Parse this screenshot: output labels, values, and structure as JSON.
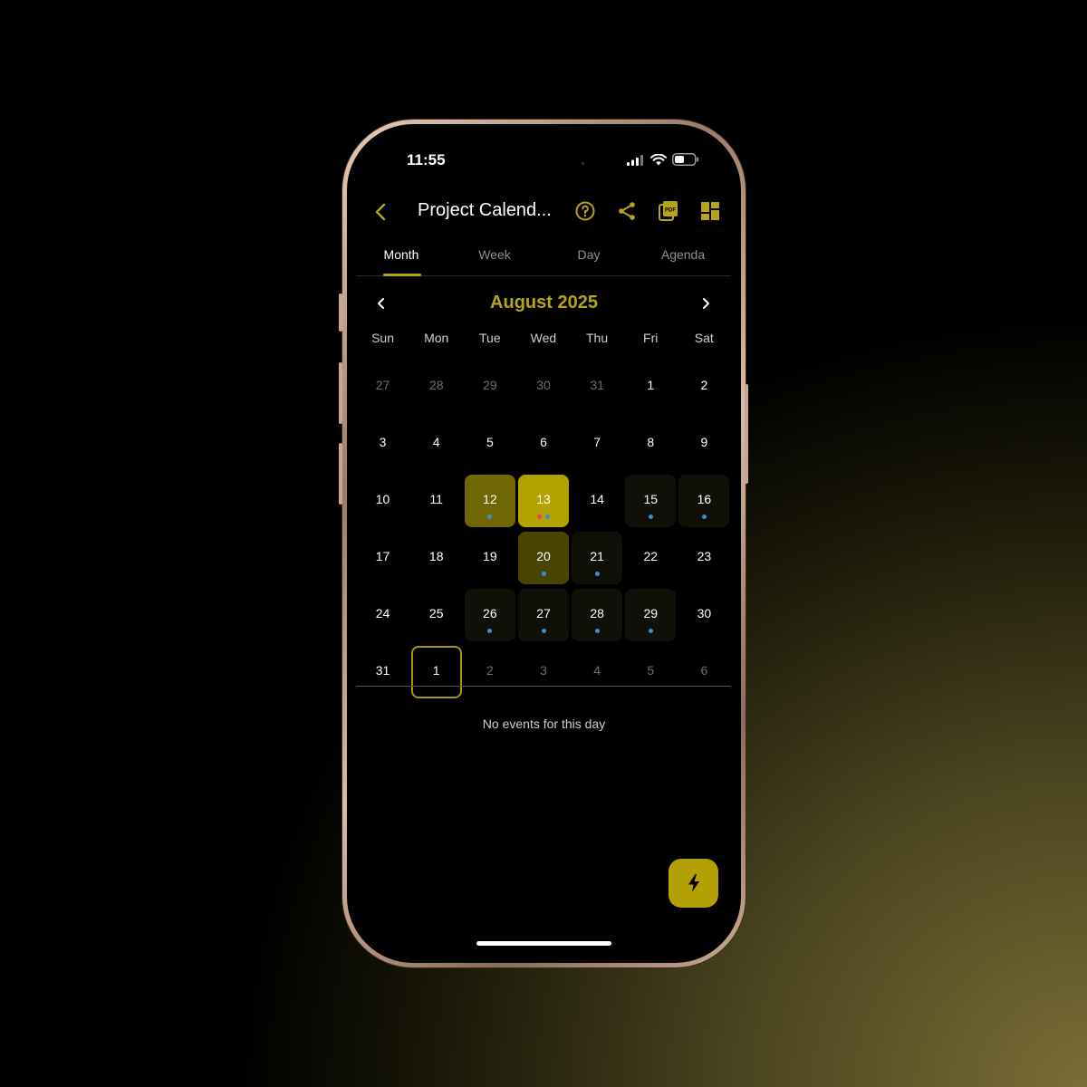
{
  "colors": {
    "accent": "#b7a516",
    "event_dot_blue": "#3a8fd8",
    "event_dot_red": "#e24a3a"
  },
  "status_bar": {
    "time": "11:55",
    "icons": [
      "signal-icon",
      "wifi-icon",
      "battery-icon"
    ]
  },
  "header": {
    "back_icon": "chevron-left-icon",
    "title": "Project Calend...",
    "actions": [
      "help-icon",
      "share-icon",
      "pdf-icon",
      "grid-icon"
    ]
  },
  "tabs": [
    "Month",
    "Week",
    "Day",
    "Agenda"
  ],
  "active_tab": "Month",
  "calendar": {
    "month_label": "August 2025",
    "prev_icon": "chevron-left-icon",
    "next_icon": "chevron-right-icon",
    "weekdays": [
      "Sun",
      "Mon",
      "Tue",
      "Wed",
      "Thu",
      "Fri",
      "Sat"
    ],
    "weeks": [
      [
        {
          "d": "27",
          "m": true
        },
        {
          "d": "28",
          "m": true
        },
        {
          "d": "29",
          "m": true
        },
        {
          "d": "30",
          "m": true
        },
        {
          "d": "31",
          "m": true
        },
        {
          "d": "1"
        },
        {
          "d": "2"
        }
      ],
      [
        {
          "d": "3"
        },
        {
          "d": "4"
        },
        {
          "d": "5"
        },
        {
          "d": "6"
        },
        {
          "d": "7"
        },
        {
          "d": "8"
        },
        {
          "d": "9"
        }
      ],
      [
        {
          "d": "10"
        },
        {
          "d": "11"
        },
        {
          "d": "12",
          "s": "s12",
          "dots": [
            "blue"
          ]
        },
        {
          "d": "13",
          "s": "s13",
          "dots": [
            "red",
            "blue"
          ]
        },
        {
          "d": "14"
        },
        {
          "d": "15",
          "s": "ev",
          "dots": [
            "blue"
          ]
        },
        {
          "d": "16",
          "s": "ev",
          "dots": [
            "blue"
          ]
        }
      ],
      [
        {
          "d": "17"
        },
        {
          "d": "18"
        },
        {
          "d": "19"
        },
        {
          "d": "20",
          "s": "s20",
          "dots": [
            "blue"
          ]
        },
        {
          "d": "21",
          "s": "ev",
          "dots": [
            "blue"
          ]
        },
        {
          "d": "22"
        },
        {
          "d": "23"
        }
      ],
      [
        {
          "d": "24"
        },
        {
          "d": "25"
        },
        {
          "d": "26",
          "s": "ev",
          "dots": [
            "blue"
          ]
        },
        {
          "d": "27",
          "s": "ev",
          "dots": [
            "blue"
          ]
        },
        {
          "d": "28",
          "s": "ev",
          "dots": [
            "blue"
          ]
        },
        {
          "d": "29",
          "s": "ev",
          "dots": [
            "blue"
          ]
        },
        {
          "d": "30"
        }
      ],
      [
        {
          "d": "31"
        },
        {
          "d": "1",
          "s": "today"
        },
        {
          "d": "2",
          "m": true
        },
        {
          "d": "3",
          "m": true
        },
        {
          "d": "4",
          "m": true
        },
        {
          "d": "5",
          "m": true
        },
        {
          "d": "6",
          "m": true
        }
      ]
    ]
  },
  "empty_message": "No events for this day",
  "fab_icon": "lightning-icon"
}
